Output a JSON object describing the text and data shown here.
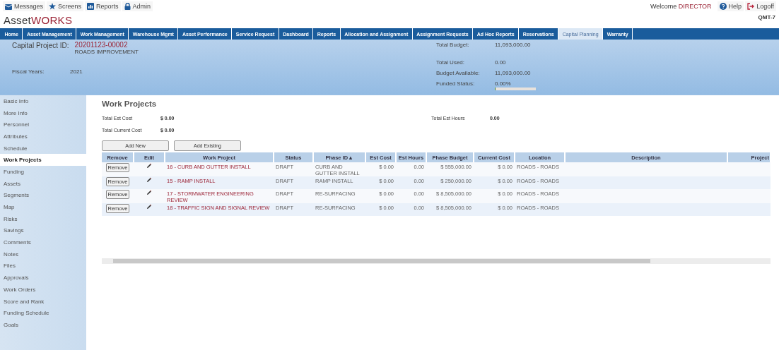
{
  "top_links": [
    {
      "label": "Messages"
    },
    {
      "label": "Screens"
    },
    {
      "label": "Reports"
    },
    {
      "label": "Admin"
    }
  ],
  "welcome": {
    "prefix": "Welcome",
    "user": "DIRECTOR"
  },
  "help": "Help",
  "logoff": "Logoff",
  "instance": "QMT-7",
  "logo": {
    "first": "Asset",
    "second": "WORKS"
  },
  "nav_tabs": [
    {
      "label": "Home",
      "selected": false
    },
    {
      "label": "Asset Management",
      "selected": false
    },
    {
      "label": "Work Management",
      "selected": false
    },
    {
      "label": "Warehouse Mgmt",
      "selected": false
    },
    {
      "label": "Asset Performance",
      "selected": false
    },
    {
      "label": "Service Request",
      "selected": false
    },
    {
      "label": "Dashboard",
      "selected": false
    },
    {
      "label": "Reports",
      "selected": false
    },
    {
      "label": "Allocation and Assignment",
      "selected": false
    },
    {
      "label": "Assignment Requests",
      "selected": false
    },
    {
      "label": "Ad Hoc Reports",
      "selected": false
    },
    {
      "label": "Reservations",
      "selected": false
    },
    {
      "label": "Capital Planning",
      "selected": true
    },
    {
      "label": "Warranty",
      "selected": false
    }
  ],
  "header": {
    "project_id_label": "Capital Project ID:",
    "project_id": "20201123-00002",
    "project_name": "ROADS IMPROVEMENT",
    "fiscal_years_label": "Fiscal Years:",
    "fiscal_years": "2021",
    "total_budget_label": "Total Budget:",
    "total_budget": "11,093,000.00",
    "total_used_label": "Total Used:",
    "total_used": "0.00",
    "budget_available_label": "Budget Available:",
    "budget_available": "11,093,000.00",
    "funded_status": {
      "label": "Funded Status:",
      "value": "0.00%",
      "level": 0
    }
  },
  "sidebar": {
    "items": [
      {
        "label": "Basic Info",
        "selected": false
      },
      {
        "label": "More Info",
        "selected": false
      },
      {
        "label": "Personnel",
        "selected": false
      },
      {
        "label": "Attributes",
        "selected": false
      },
      {
        "label": "Schedule",
        "selected": false
      },
      {
        "label": "Work Projects",
        "selected": true
      },
      {
        "label": "Funding",
        "selected": false
      },
      {
        "label": "Assets",
        "selected": false
      },
      {
        "label": "Segments",
        "selected": false
      },
      {
        "label": "Map",
        "selected": false
      },
      {
        "label": "Risks",
        "selected": false
      },
      {
        "label": "Savings",
        "selected": false
      },
      {
        "label": "Comments",
        "selected": false
      },
      {
        "label": "Notes",
        "selected": false
      },
      {
        "label": "Files",
        "selected": false
      },
      {
        "label": "Approvals",
        "selected": false
      },
      {
        "label": "Work Orders",
        "selected": false
      },
      {
        "label": "Score and Rank",
        "selected": false
      },
      {
        "label": "Funding Schedule",
        "selected": false
      },
      {
        "label": "Goals",
        "selected": false
      }
    ]
  },
  "content": {
    "title": "Work Projects",
    "total_est_cost_label": "Total Est Cost",
    "total_est_cost": "$ 0.00",
    "total_current_cost_label": "Total Current Cost",
    "total_current_cost": "$ 0.00",
    "total_est_hours_label": "Total Est Hours",
    "total_est_hours": "0.00",
    "buttons": [
      "Add New",
      "Add Existing"
    ],
    "table": {
      "columns": [
        {
          "label": "Remove",
          "sorted": false
        },
        {
          "label": "Edit",
          "sorted": false
        },
        {
          "label": "Work Project",
          "sorted": false
        },
        {
          "label": "Status",
          "sorted": false
        },
        {
          "label": "Phase ID",
          "sorted": true
        },
        {
          "label": "Est Cost",
          "sorted": false
        },
        {
          "label": "Est Hours",
          "sorted": false
        },
        {
          "label": "Phase Budget",
          "sorted": false
        },
        {
          "label": "Current Cost",
          "sorted": false
        },
        {
          "label": "Location",
          "sorted": false
        },
        {
          "label": "Description",
          "sorted": false
        },
        {
          "label": "Project",
          "sorted": false
        }
      ],
      "sort_mark": "▲",
      "rows": [
        {
          "remove": "Remove",
          "work_project": "16 - CURB AND GUTTER INSTALL",
          "status": "DRAFT",
          "phase_id": "CURB AND GUTTER INSTALL",
          "est_cost": "$ 0.00",
          "est_hours": "0.00",
          "phase_budget": "$ 555,000.00",
          "current_cost": "$ 0.00",
          "location": "ROADS - ROADS"
        },
        {
          "remove": "Remove",
          "work_project": "15 - RAMP INSTALL",
          "status": "DRAFT",
          "phase_id": "RAMP INSTALL",
          "est_cost": "$ 0.00",
          "est_hours": "0.00",
          "phase_budget": "$ 250,000.00",
          "current_cost": "$ 0.00",
          "location": "ROADS - ROADS"
        },
        {
          "remove": "Remove",
          "work_project": "17 - STORMWATER ENGINEERING REVIEW",
          "status": "DRAFT",
          "phase_id": "RE-SURFACING",
          "est_cost": "$ 0.00",
          "est_hours": "0.00",
          "phase_budget": "$ 8,505,000.00",
          "current_cost": "$ 0.00",
          "location": "ROADS - ROADS"
        },
        {
          "remove": "Remove",
          "work_project": "18 - TRAFFIC SIGN AND SIGNAL REVIEW",
          "status": "DRAFT",
          "phase_id": "RE-SURFACING",
          "est_cost": "$ 0.00",
          "est_hours": "0.00",
          "phase_budget": "$ 8,505,000.00",
          "current_cost": "$ 0.00",
          "location": "ROADS - ROADS"
        }
      ]
    }
  }
}
